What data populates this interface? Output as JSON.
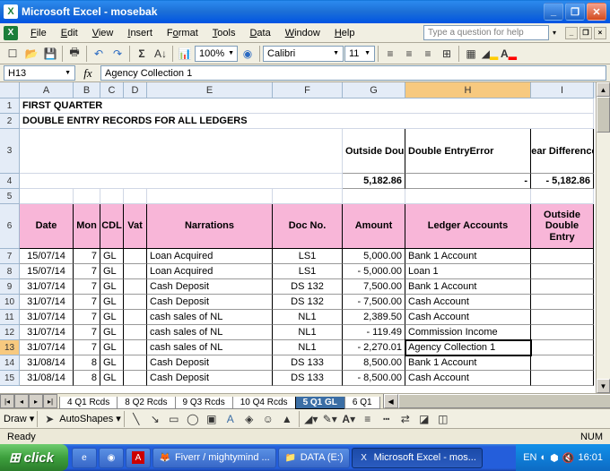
{
  "window": {
    "title": "Microsoft Excel - mosebak",
    "menus": [
      "File",
      "Edit",
      "View",
      "Insert",
      "Format",
      "Tools",
      "Data",
      "Window",
      "Help"
    ],
    "help_placeholder": "Type a question for help"
  },
  "toolbar": {
    "zoom": "100%",
    "font": "Calibri",
    "fontsize": "11"
  },
  "namebox": "H13",
  "formula": "Agency Collection 1",
  "columns": [
    {
      "id": "A",
      "w": 60,
      "label": "A"
    },
    {
      "id": "B",
      "w": 30,
      "label": "B"
    },
    {
      "id": "C",
      "w": 26,
      "label": "C"
    },
    {
      "id": "D",
      "w": 26,
      "label": "D"
    },
    {
      "id": "E",
      "w": 140,
      "label": "E"
    },
    {
      "id": "F",
      "w": 78,
      "label": "F"
    },
    {
      "id": "G",
      "w": 70,
      "label": "G"
    },
    {
      "id": "H",
      "w": 140,
      "label": "H"
    },
    {
      "id": "I",
      "w": 70,
      "label": "I"
    }
  ],
  "title_rows": {
    "r1": "FIRST QUARTER",
    "r2": "DOUBLE ENTRY RECORDS FOR ALL LEDGERS"
  },
  "summary": {
    "g3": "Outside Double Entry",
    "h3": "Double EntryError",
    "i3": "Clear Differences",
    "g4": "5,182.86",
    "h4": "-",
    "i4": "-  5,182.86"
  },
  "headers": {
    "A": "Date",
    "B": "Mon",
    "C": "CDL",
    "D": "Vat",
    "E": "Narrations",
    "F": "Doc No.",
    "G": "Amount",
    "H": "Ledger Accounts",
    "I": "Outside Double Entry"
  },
  "rows": [
    {
      "n": 7,
      "A": "15/07/14",
      "B": "7",
      "C": "GL",
      "D": "",
      "E": "Loan Acquired",
      "F": "LS1",
      "G": "5,000.00",
      "H": "Bank 1 Account"
    },
    {
      "n": 8,
      "A": "15/07/14",
      "B": "7",
      "C": "GL",
      "D": "",
      "E": "Loan Acquired",
      "F": "LS1",
      "G": "-      5,000.00",
      "H": "Loan 1"
    },
    {
      "n": 9,
      "A": "31/07/14",
      "B": "7",
      "C": "GL",
      "D": "",
      "E": "Cash Deposit",
      "F": "DS 132",
      "G": "7,500.00",
      "H": "Bank 1 Account"
    },
    {
      "n": 10,
      "A": "31/07/14",
      "B": "7",
      "C": "GL",
      "D": "",
      "E": "Cash Deposit",
      "F": "DS 132",
      "G": "-      7,500.00",
      "H": "Cash Account"
    },
    {
      "n": 11,
      "A": "31/07/14",
      "B": "7",
      "C": "GL",
      "D": "",
      "E": "cash sales of NL",
      "F": "NL1",
      "G": "2,389.50",
      "H": "Cash Account"
    },
    {
      "n": 12,
      "A": "31/07/14",
      "B": "7",
      "C": "GL",
      "D": "",
      "E": "cash sales of NL",
      "F": "NL1",
      "G": "-         119.49",
      "H": "Commission Income"
    },
    {
      "n": 13,
      "A": "31/07/14",
      "B": "7",
      "C": "GL",
      "D": "",
      "E": "cash sales of NL",
      "F": "NL1",
      "G": "-      2,270.01",
      "H": "Agency Collection 1"
    },
    {
      "n": 14,
      "A": "31/08/14",
      "B": "8",
      "C": "GL",
      "D": "",
      "E": "Cash Deposit",
      "F": "DS 133",
      "G": "8,500.00",
      "H": "Bank 1 Account"
    },
    {
      "n": 15,
      "A": "31/08/14",
      "B": "8",
      "C": "GL",
      "D": "",
      "E": "Cash Deposit",
      "F": "DS 133",
      "G": "-      8,500.00",
      "H": "Cash Account"
    }
  ],
  "tabs": [
    "4 Q1 Rcds",
    "8 Q2 Rcds",
    "9 Q3 Rcds",
    "10 Q4 Rcds",
    "5 Q1 GL",
    "6 Q1"
  ],
  "active_tab": 4,
  "draw": {
    "label": "Draw",
    "autoshapes": "AutoShapes"
  },
  "status": {
    "ready": "Ready",
    "num": "NUM"
  },
  "taskbar": {
    "start": "click",
    "items": [
      {
        "icon": "🦊",
        "label": "Fiverr / mightymind ...",
        "active": false
      },
      {
        "icon": "📁",
        "label": "DATA (E:)",
        "active": false
      },
      {
        "icon": "X",
        "label": "Microsoft Excel - mos...",
        "active": true
      }
    ],
    "lang": "EN",
    "time": "16:01"
  }
}
